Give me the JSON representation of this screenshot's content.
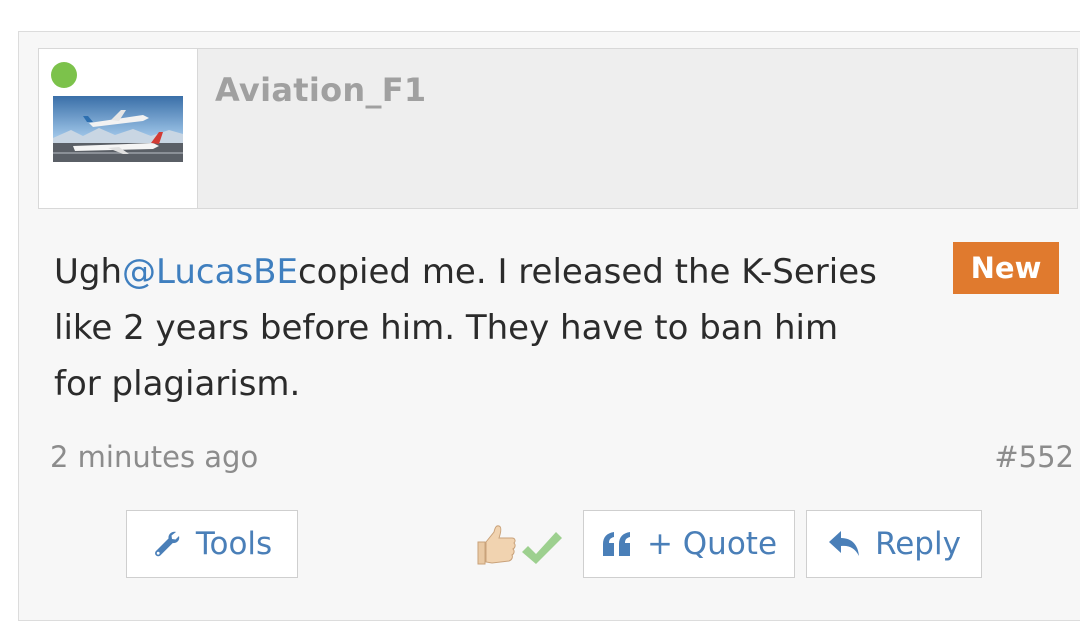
{
  "post": {
    "author": {
      "username": "Aviation_F1",
      "status": "online",
      "status_color": "#7cc24b"
    },
    "message": {
      "prefix": "Ugh",
      "mention": "@LucasBE",
      "line1_rest": "copied me. I released the K-Series",
      "line2": "like 2 years before him. They have to ban him",
      "line3": "for plagiarism."
    },
    "badge": {
      "label": "New",
      "color": "#e07a2e"
    },
    "timestamp": "2 minutes ago",
    "post_number": "#552",
    "actions": {
      "tools_label": "Tools",
      "quote_label": "+ Quote",
      "reply_label": "Reply"
    },
    "reactions": [
      "thumbs-up-icon",
      "checkmark-icon"
    ]
  },
  "colors": {
    "link": "#3f7fbf",
    "button_text": "#4a7fb8",
    "muted_text": "#8c8c8c"
  }
}
